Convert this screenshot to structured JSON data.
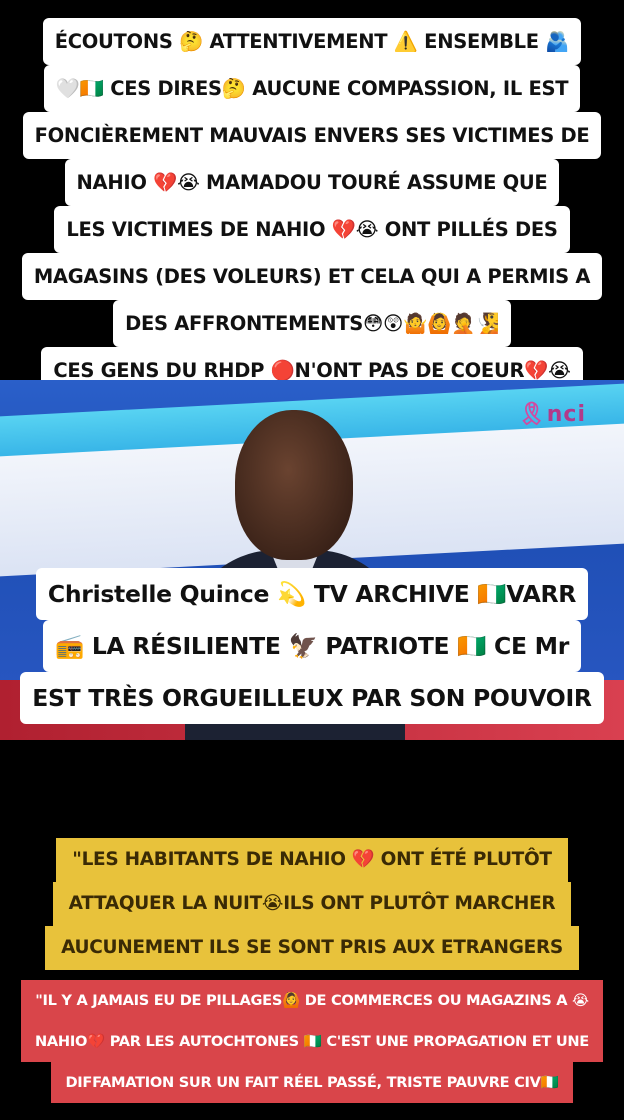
{
  "top_caption": {
    "lines": [
      "ÉCOUTONS 🤔 ATTENTIVEMENT ⚠️ ENSEMBLE 🫂",
      "🤍🇨🇮 CES DIRES🤔 AUCUNE COMPASSION, IL EST",
      "FONCIÈREMENT MAUVAIS ENVERS SES VICTIMES DE",
      "NAHIO 💔😭 MAMADOU TOURÉ ASSUME QUE",
      "LES VICTIMES DE NAHIO 💔😭 ONT PILLÉS DES",
      "MAGASINS (DES VOLEURS) ET CELA QUI A PERMIS A",
      "DES  AFFRONTEMENTS😳😲🤷🙆🤦🧏",
      "CES GENS DU RHDP 🔴N'ONT PAS DE COEUR💔😭"
    ]
  },
  "video": {
    "channel_logo": "nci",
    "logo_ribbon": "🎗"
  },
  "mid_caption": {
    "lines": [
      "Christelle Quince 💫 TV ARCHIVE 🇨🇮VARR",
      "📻 LA RÉSILIENTE 🦅 PATRIOTE 🇨🇮 CE Mr",
      "EST TRÈS ORGUEILLEUX PAR SON POUVOIR"
    ]
  },
  "yellow_caption": {
    "lines": [
      "\"LES HABITANTS DE NAHIO 💔 ONT ÉTÉ PLUTÔT",
      "ATTAQUER LA NUIT😭ILS ONT PLUTÔT MARCHER",
      "AUCUNEMENT ILS SE SONT PRIS AUX ETRANGERS"
    ]
  },
  "red_caption": {
    "lines": [
      "\"IL Y A JAMAIS EU DE PILLAGES🙆 DE COMMERCES OU MAGAZINS A 😭",
      "NAHIO💔 PAR LES AUTOCHTONES 🇨🇮 C'EST UNE PROPAGATION ET UNE",
      "DIFFAMATION SUR UN FAIT RÉEL PASSÉ, TRISTE PAUVRE CIV🇨🇮"
    ]
  }
}
